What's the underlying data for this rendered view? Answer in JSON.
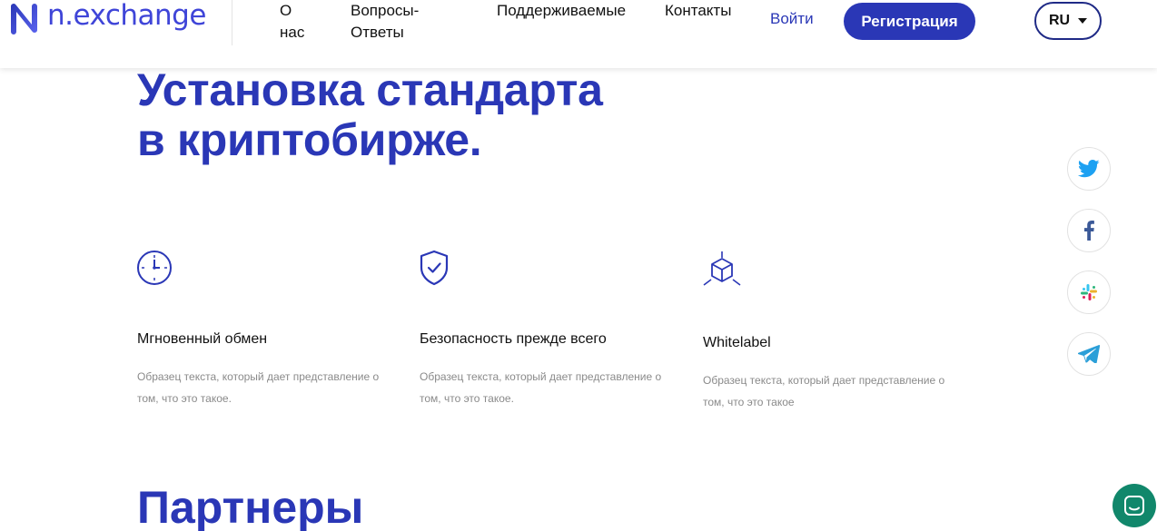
{
  "header": {
    "logo_text": "n.exchange",
    "nav": {
      "about": "О нас",
      "faq": "Вопросы-Ответы",
      "supported": "Поддерживаемые",
      "contacts": "Контакты"
    },
    "login": "Войти",
    "register": "Регистрация",
    "language": "RU"
  },
  "hero": {
    "title_line1": "Установка стандарта",
    "title_line2": "в криптобирже."
  },
  "features": [
    {
      "icon": "clock-icon",
      "title": "Мгновенный обмен",
      "description": "Образец текста, который дает представление о том, что это такое."
    },
    {
      "icon": "shield-check-icon",
      "title": "Безопасность прежде всего",
      "description": "Образец текста, который дает представление о том, что это такое."
    },
    {
      "icon": "cube-icon",
      "title": "Whitelabel",
      "description": "Образец текста, который дает представление о том, что это такое"
    }
  ],
  "social": [
    "twitter-icon",
    "facebook-icon",
    "slack-icon",
    "telegram-icon"
  ],
  "partners": {
    "title": "Партнеры"
  },
  "colors": {
    "brand_blue": "#2a37b6",
    "logo_blue": "#3f45d8",
    "chat_green": "#11876b",
    "twitter": "#1da1f2",
    "telegram": "#2b9fd8"
  }
}
